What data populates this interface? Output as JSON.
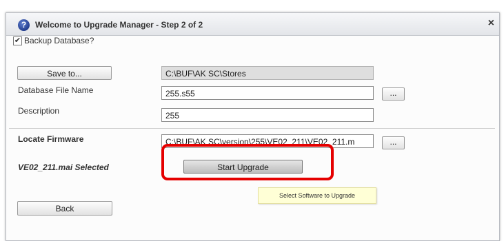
{
  "dialog": {
    "title": "Welcome to Upgrade Manager - Step 2 of 2",
    "help_icon_glyph": "?",
    "close_glyph": "×"
  },
  "backup": {
    "checkbox_label": "Backup Database?",
    "checked": true,
    "check_glyph": "✔"
  },
  "save": {
    "button_label": "Save to...",
    "path_value": "C:\\BUF\\AK SC\\Stores"
  },
  "db_file": {
    "label": "Database File Name",
    "value": "255.s55",
    "browse_label": "..."
  },
  "description": {
    "label": "Description",
    "value": "255"
  },
  "firmware": {
    "label": "Locate Firmware",
    "value": "C:\\BUF\\AK SC\\version\\255\\VE02_211\\VE02_211.m",
    "browse_label": "..."
  },
  "upgrade": {
    "selected_text": "VE02_211.mai Selected",
    "start_button_label": "Start Upgrade",
    "highlight_color": "#e50000"
  },
  "tooltip": {
    "text": "Select Software to Upgrade"
  },
  "navigation": {
    "back_label": "Back"
  }
}
